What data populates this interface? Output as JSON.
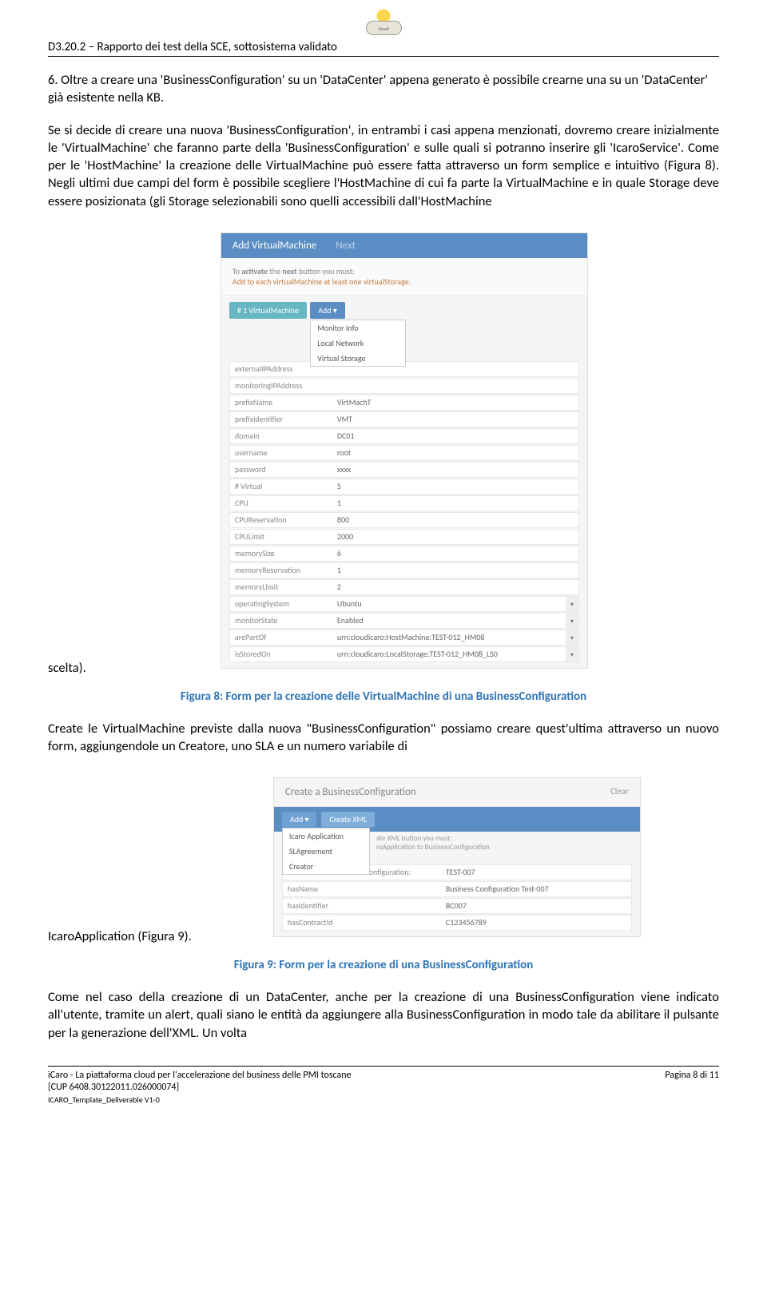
{
  "header": {
    "doc_ref": "D3.20.2 – Rapporto dei test della SCE, sottosistema validato",
    "logo_label": "cloud"
  },
  "para6_start": "6. Oltre a creare una 'BusinessConfiguration' su un 'DataCenter' appena generato è possibile crearne una su un 'DataCenter' già esistente nella KB.",
  "main_para": "Se si decide di creare una nuova 'BusinessConfiguration', in entrambi i casi appena menzionati, dovremo creare inizialmente le 'VirtualMachine' che faranno parte della 'BusinessConfiguration' e sulle quali si potranno inserire gli 'IcaroService'. Come per le 'HostMachine' la creazione delle VirtualMachine può essere fatta attraverso un form semplice e intuitivo (Figura 8). Negli ultimi due campi del form è possibile scegliere l'HostMachine  di cui fa parte la VirtualMachine e in quale Storage deve essere posizionata (gli Storage selezionabili sono quelli accessibili dall'HostMachine",
  "trailing1": "scelta).",
  "screenshot1": {
    "title": "Add VirtualMachine",
    "next": "Next",
    "notice_l1": "To activate the next button you must:",
    "notice_l2": "Add to each virtualMachine at least one virtualStorage.",
    "vm_badge": "# 1 VirtualMachine",
    "add_label": "Add ▾",
    "dropdown": [
      "Monitor Info",
      "Local Network",
      "Virtual Storage"
    ],
    "rows": [
      {
        "label": "externalIPAddress",
        "value": ""
      },
      {
        "label": "monitoringIPAddress",
        "value": ""
      },
      {
        "label": "prefixName",
        "value": "VirtMachT"
      },
      {
        "label": "prefixIdentifier",
        "value": "VMT"
      },
      {
        "label": "domain",
        "value": "DC01"
      },
      {
        "label": "username",
        "value": "root"
      },
      {
        "label": "password",
        "value": "xxxx"
      },
      {
        "label": "# Virtual",
        "value": "5"
      },
      {
        "label": "CPU",
        "value": "1"
      },
      {
        "label": "CPUReservation",
        "value": "800"
      },
      {
        "label": "CPULimit",
        "value": "2000"
      },
      {
        "label": "memorySize",
        "value": "6"
      },
      {
        "label": "memoryReservation",
        "value": "1"
      },
      {
        "label": "memoryLimit",
        "value": "2"
      },
      {
        "label": "operatingSystem",
        "value": "Ubuntu",
        "select": true
      },
      {
        "label": "monitorState",
        "value": "Enabled",
        "select": true
      },
      {
        "label": "arePartOf",
        "value": "urn:cloudicaro:HostMachine:TEST-012_HM08",
        "select": true
      },
      {
        "label": "isStoredOn",
        "value": "urn:cloudicaro:LocalStorage:TEST-012_HM08_LS0",
        "select": true
      }
    ]
  },
  "caption1": "Figura 8: Form per la creazione delle VirtualMachine di una BusinessConfiguration",
  "para_after1": "Create le VirtualMachine previste dalla nuova \"BusinessConfiguration\" possiamo creare quest'ultima attraverso un nuovo form, aggiungendole un Creatore, uno SLA e un numero variabile di",
  "trailing2": "IcaroApplication (Figura 9).",
  "screenshot2": {
    "title": "Create a BusinessConfiguration",
    "clear": "Clear",
    "add": "Add ▾",
    "createxml": "Create XML",
    "dd": [
      "Icaro Application",
      "SLAgreement",
      "Creator"
    ],
    "notice1": "ate XML button you must:",
    "notice2": "roApplication to BusinessConfiguration",
    "rows": [
      {
        "label": "urn:cloudicaro:BusinessConfiguration:",
        "value": "TEST-007"
      },
      {
        "label": "hasName",
        "value": "Business Configuration Test-007"
      },
      {
        "label": "hasIdentifier",
        "value": "BC007"
      },
      {
        "label": "hasContractId",
        "value": "C123456789"
      }
    ]
  },
  "caption2": "Figura 9: Form per la creazione di una BusinessConfiguration",
  "para_final": "Come nel caso della creazione di un DataCenter, anche per la creazione di una BusinessConfiguration viene indicato all'utente, tramite un alert, quali siano le entità da aggiungere alla BusinessConfiguration in modo tale da abilitare il pulsante per la generazione dell'XML. Un volta",
  "footer": {
    "line1": "iCaro - La piattaforma cloud per l'accelerazione del business delle PMI toscane",
    "line2": "[CUP 6408.30122011.026000074]",
    "line3": "ICARO_Template_Deliverable V1-0",
    "page": "Pagina 8 di 11"
  }
}
